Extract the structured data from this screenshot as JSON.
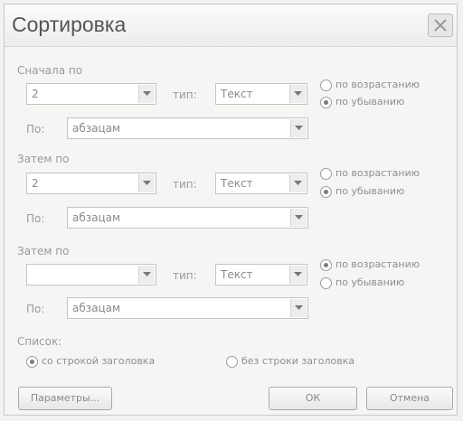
{
  "dialog": {
    "title": "Сортировка",
    "close_icon": "close-icon"
  },
  "sections": [
    {
      "header": "Сначала по",
      "field_value": "2",
      "type_label": "тип:",
      "type_value": "Текст",
      "by_label": "По:",
      "by_value": "абзацам",
      "asc_label": "по возрастанию",
      "desc_label": "по убыванию",
      "selected": "desc"
    },
    {
      "header": "Затем по",
      "field_value": "2",
      "type_label": "тип:",
      "type_value": "Текст",
      "by_label": "По:",
      "by_value": "абзацам",
      "asc_label": "по возрастанию",
      "desc_label": "по убыванию",
      "selected": "desc"
    },
    {
      "header": "Затем по",
      "field_value": "",
      "type_label": "тип:",
      "type_value": "Текст",
      "by_label": "По:",
      "by_value": "абзацам",
      "asc_label": "по возрастанию",
      "desc_label": "по убыванию",
      "selected": "asc"
    }
  ],
  "list": {
    "header": "Список:",
    "with_header_label": "со строкой заголовка",
    "without_header_label": "без строки заголовка",
    "selected": "with"
  },
  "buttons": {
    "params": "Параметры...",
    "ok": "ОК",
    "cancel": "Отмена"
  }
}
